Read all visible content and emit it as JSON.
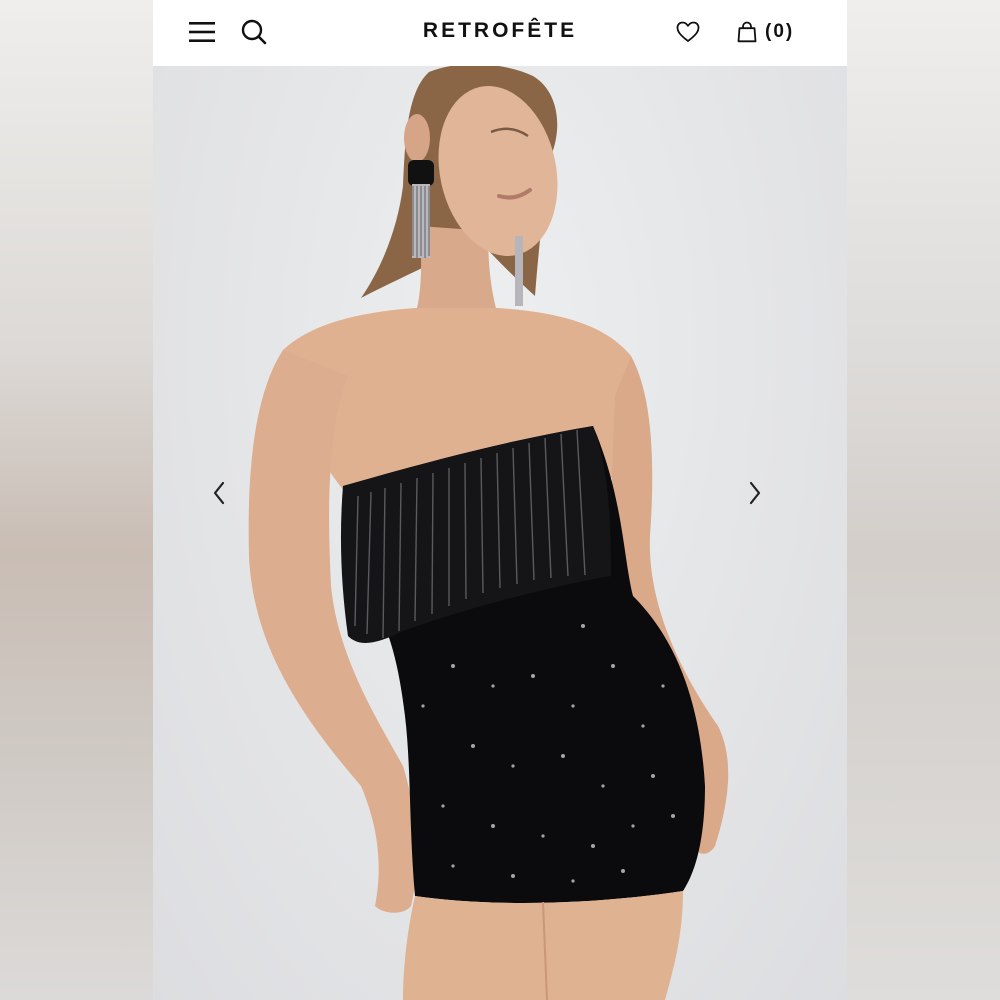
{
  "header": {
    "brand": "RETROFÊTE",
    "bag_count": "(0)",
    "icons": {
      "menu": "hamburger-menu-icon",
      "search": "search-icon",
      "wishlist": "heart-icon",
      "bag": "shopping-bag-icon"
    }
  },
  "product_image": {
    "prev": "chevron-left-icon",
    "next": "chevron-right-icon"
  },
  "colors": {
    "header_bg": "#ffffff",
    "text": "#111111",
    "backdrop": "#e5e6e8",
    "dress": "#0b0b0d"
  }
}
